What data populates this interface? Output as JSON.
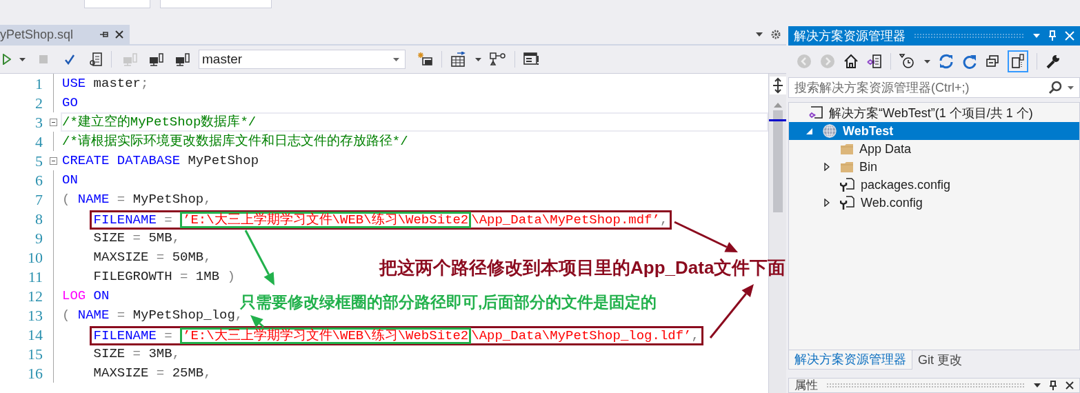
{
  "editor_tab": {
    "title": "yPetShop.sql",
    "selected": true
  },
  "sql_toolbar": {
    "database": "master"
  },
  "code_lines": [
    {
      "num": "1",
      "current": false,
      "foldable": false,
      "segments": [
        {
          "kind": "keyword",
          "text": "USE"
        },
        {
          "kind": "plain",
          "text": " master"
        },
        {
          "kind": "punct",
          "text": ";"
        }
      ]
    },
    {
      "num": "2",
      "current": false,
      "foldable": false,
      "segments": [
        {
          "kind": "keyword",
          "text": "GO"
        }
      ]
    },
    {
      "num": "3",
      "current": true,
      "foldable": true,
      "segments": [
        {
          "kind": "comment",
          "text": "/*建立空的MyPetShop数据库*/"
        }
      ]
    },
    {
      "num": "4",
      "current": false,
      "foldable": false,
      "segments": [
        {
          "kind": "comment",
          "text": "/*请根据实际环境更改数据库文件和日志文件的存放路径*/"
        }
      ]
    },
    {
      "num": "5",
      "current": false,
      "foldable": true,
      "segments": [
        {
          "kind": "keyword",
          "text": "CREATE DATABASE"
        },
        {
          "kind": "plain",
          "text": " MyPetShop"
        }
      ]
    },
    {
      "num": "6",
      "current": false,
      "foldable": false,
      "segments": [
        {
          "kind": "keyword",
          "text": "ON"
        }
      ]
    },
    {
      "num": "7",
      "current": false,
      "foldable": false,
      "segments": [
        {
          "kind": "punct",
          "text": "( "
        },
        {
          "kind": "keyword",
          "text": "NAME"
        },
        {
          "kind": "punct",
          "text": " = "
        },
        {
          "kind": "plain",
          "text": "MyPetShop"
        },
        {
          "kind": "punct",
          "text": ","
        }
      ]
    },
    {
      "num": "8",
      "current": false,
      "foldable": false,
      "segments": [
        {
          "kind": "keyword",
          "text": "    FILENAME"
        },
        {
          "kind": "punct",
          "text": " = "
        },
        {
          "kind": "string",
          "text": "’E:\\大三上学期学习文件\\WEB\\练习\\WebSite2"
        },
        {
          "kind": "string",
          "text": "\\App_Data\\MyPetShop.mdf’"
        },
        {
          "kind": "punct",
          "text": ","
        }
      ]
    },
    {
      "num": "9",
      "current": false,
      "foldable": false,
      "segments": [
        {
          "kind": "plain",
          "text": "    SIZE"
        },
        {
          "kind": "punct",
          "text": " = "
        },
        {
          "kind": "plain",
          "text": "5MB"
        },
        {
          "kind": "punct",
          "text": ","
        }
      ]
    },
    {
      "num": "10",
      "current": false,
      "foldable": false,
      "segments": [
        {
          "kind": "plain",
          "text": "    MAXSIZE"
        },
        {
          "kind": "punct",
          "text": " = "
        },
        {
          "kind": "plain",
          "text": "50MB"
        },
        {
          "kind": "punct",
          "text": ","
        }
      ]
    },
    {
      "num": "11",
      "current": false,
      "foldable": false,
      "segments": [
        {
          "kind": "plain",
          "text": "    FILEGROWTH"
        },
        {
          "kind": "punct",
          "text": " = "
        },
        {
          "kind": "plain",
          "text": "1MB"
        },
        {
          "kind": "punct",
          "text": " )"
        }
      ]
    },
    {
      "num": "12",
      "current": false,
      "foldable": false,
      "segments": [
        {
          "kind": "magenta",
          "text": "LOG"
        },
        {
          "kind": "keyword",
          "text": " ON"
        }
      ]
    },
    {
      "num": "13",
      "current": false,
      "foldable": false,
      "segments": [
        {
          "kind": "punct",
          "text": "( "
        },
        {
          "kind": "keyword",
          "text": "NAME"
        },
        {
          "kind": "punct",
          "text": " = "
        },
        {
          "kind": "plain",
          "text": "MyPetShop_log"
        },
        {
          "kind": "punct",
          "text": ","
        }
      ]
    },
    {
      "num": "14",
      "current": false,
      "foldable": false,
      "segments": [
        {
          "kind": "keyword",
          "text": "    FILENAME"
        },
        {
          "kind": "punct",
          "text": " = "
        },
        {
          "kind": "string",
          "text": "’E:\\大三上学期学习文件\\WEB\\练习\\WebSite2"
        },
        {
          "kind": "string",
          "text": "\\App_Data\\MyPetShop_log.ldf’"
        },
        {
          "kind": "punct",
          "text": ","
        }
      ]
    },
    {
      "num": "15",
      "current": false,
      "foldable": false,
      "segments": [
        {
          "kind": "plain",
          "text": "    SIZE"
        },
        {
          "kind": "punct",
          "text": " = "
        },
        {
          "kind": "plain",
          "text": "3MB"
        },
        {
          "kind": "punct",
          "text": ","
        }
      ]
    },
    {
      "num": "16",
      "current": false,
      "foldable": false,
      "segments": [
        {
          "kind": "plain",
          "text": "    MAXSIZE"
        },
        {
          "kind": "punct",
          "text": " = "
        },
        {
          "kind": "plain",
          "text": "25MB"
        },
        {
          "kind": "punct",
          "text": ","
        }
      ]
    }
  ],
  "solution_explorer": {
    "title": "解决方案资源管理器",
    "search": {
      "placeholder": "搜索解决方案资源管理器(Ctrl+;)"
    },
    "tree": [
      {
        "kind": "solution",
        "label": "解决方案“WebTest”(1 个项目/共 1 个)",
        "selected": false,
        "expandable": false,
        "children": [
          {
            "kind": "project",
            "label": "WebTest",
            "selected": true,
            "expandable": true,
            "expanded": true,
            "children": [
              {
                "kind": "folder",
                "label": "App Data",
                "selected": false,
                "expandable": false
              },
              {
                "kind": "folder",
                "label": "Bin",
                "selected": false,
                "expandable": true,
                "expanded": false
              },
              {
                "kind": "config",
                "label": "packages.config",
                "selected": false,
                "expandable": false
              },
              {
                "kind": "config",
                "label": "Web.config",
                "selected": false,
                "expandable": true,
                "expanded": false
              }
            ]
          }
        ]
      }
    ],
    "bottom_tabs": [
      {
        "label": "解决方案资源管理器",
        "selected": true
      },
      {
        "label": "Git 更改",
        "selected": false
      }
    ]
  },
  "properties_panel": {
    "title": "属性"
  },
  "annotations": [
    {
      "text": "把这两个路径修改到本项目里的App_Data文件下面",
      "color": "#8b0a1e"
    },
    {
      "text": "只需要修改绿框圈的部分路径即可,后面部分的文件是固定的",
      "color": "#22b14c"
    }
  ]
}
